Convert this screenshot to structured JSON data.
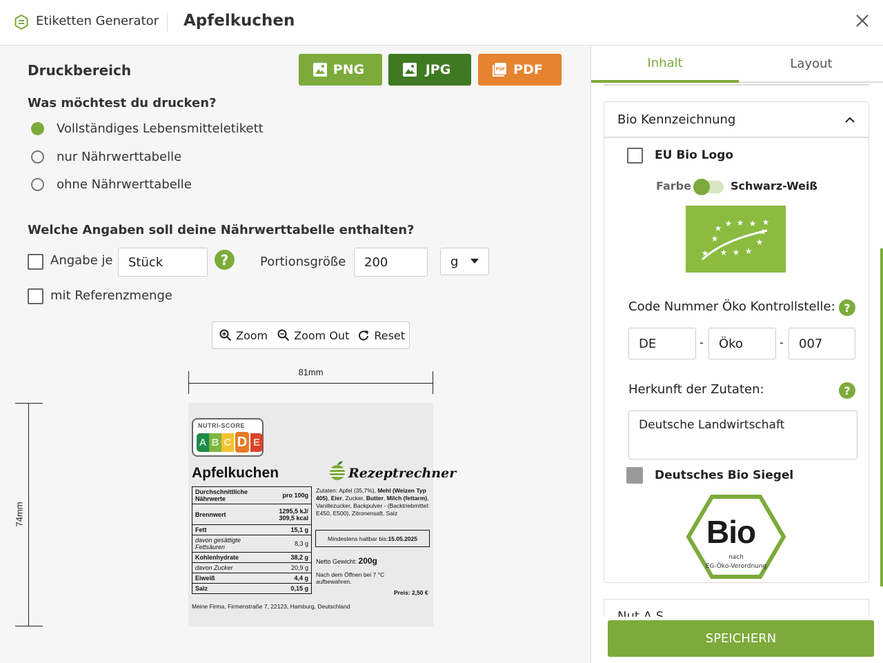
{
  "header": {
    "app_name": "Etiketten Generator",
    "title": "Apfelkuchen"
  },
  "left": {
    "section_title": "Druckbereich",
    "export_buttons": [
      {
        "label": "PNG",
        "color": "#7cab3b"
      },
      {
        "label": "JPG",
        "color": "#3f7a22"
      },
      {
        "label": "PDF",
        "color": "#e6832e"
      }
    ],
    "print_question": "Was möchtest du drucken?",
    "print_options": [
      "Vollständiges Lebensmitteletikett",
      "nur Nährwerttabelle",
      "ohne Nährwerttabelle"
    ],
    "print_selected": 0,
    "nutri_question": "Welche Angaben soll deine Nährwerttabelle enthalten?",
    "per_label": "Angabe je",
    "per_value": "Stück",
    "portion_label": "Portionsgröße",
    "portion_value": "200",
    "portion_unit": "g",
    "reference_label": "mit Referenzmenge",
    "zoom": {
      "zoom_in": "Zoom",
      "zoom_out": "Zoom Out",
      "reset": "Reset"
    },
    "width_dim": "81mm",
    "height_dim": "74mm"
  },
  "label": {
    "nutriscore_title": "NUTRI-SCORE",
    "nutriscore_letters": [
      "A",
      "B",
      "C",
      "D",
      "E"
    ],
    "nutriscore_active": "D",
    "product": "Apfelkuchen",
    "brand": "Rezeptrechner",
    "table_head_left": "Durchschnittliche Nährwerte",
    "table_head_right": "pro 100g",
    "rows": [
      {
        "name": "Brennwert",
        "value": "1295,5 kJ/ 309,5 kcal",
        "style": "b"
      },
      {
        "name": "Fett",
        "value": "15,1 g",
        "style": "b"
      },
      {
        "name": "davon gesättigte Fettsäuren",
        "value": "8,3 g",
        "style": "it"
      },
      {
        "name": "Kohlenhydrate",
        "value": "38,2 g",
        "style": "b"
      },
      {
        "name": "davon Zucker",
        "value": "20,9 g",
        "style": "it"
      },
      {
        "name": "Eiweiß",
        "value": "4,4 g",
        "style": "b"
      },
      {
        "name": "Salz",
        "value": "0,15 g",
        "style": "b"
      }
    ],
    "ingredients_prefix": "Zutaten: Apfel (35,7%), ",
    "ingredients_b1": "Mehl (Weizen Typ 405)",
    "ingredients_s1": ", ",
    "ingredients_b2": "Eier",
    "ingredients_s2": ", Zucker, ",
    "ingredients_b3": "Butter",
    "ingredients_s3": ", ",
    "ingredients_b4": "Milch (fettarm)",
    "ingredients_s4": ", Vanillezucker, Backpulver - (Backtriebmittel: E450, E500), Zitronensaft, Salz",
    "mhd_label": "Mindestens haltbar bis: ",
    "mhd_date": "15.05.2025",
    "netto_label": "Netto Gewicht: ",
    "netto_value": "200g",
    "open_note": "Nach dem Öffnen bei 7 °C aufbewahren.",
    "price": "Preis: 2,50 €",
    "address": "Meine Firma, Firmenstraße 7, 22123, Hamburg, Deutschland"
  },
  "right": {
    "tabs": [
      "Inhalt",
      "Layout"
    ],
    "active_tab": "Inhalt",
    "accent": "#7cab3b",
    "card_title": "Bio Kennzeichnung",
    "eu_logo_label": "EU Bio Logo",
    "color_label": "Farbe",
    "bw_label": "Schwarz-Weiß",
    "code_label": "Code Nummer Öko Kontrollstelle:",
    "code_parts": [
      "DE",
      "Öko",
      "007"
    ],
    "code_sep": "-",
    "origin_label": "Herkunft der Zutaten:",
    "origin_value": "Deutsche Landwirtschaft",
    "de_siegel_label": "Deutsches Bio Siegel",
    "bio_word": "Bio",
    "bio_sub1": "nach",
    "bio_sub2": "EG-Öko-Verordnung",
    "next_card_partial": "Nut A S",
    "save_label": "SPEICHERN"
  },
  "help_glyph": "?"
}
